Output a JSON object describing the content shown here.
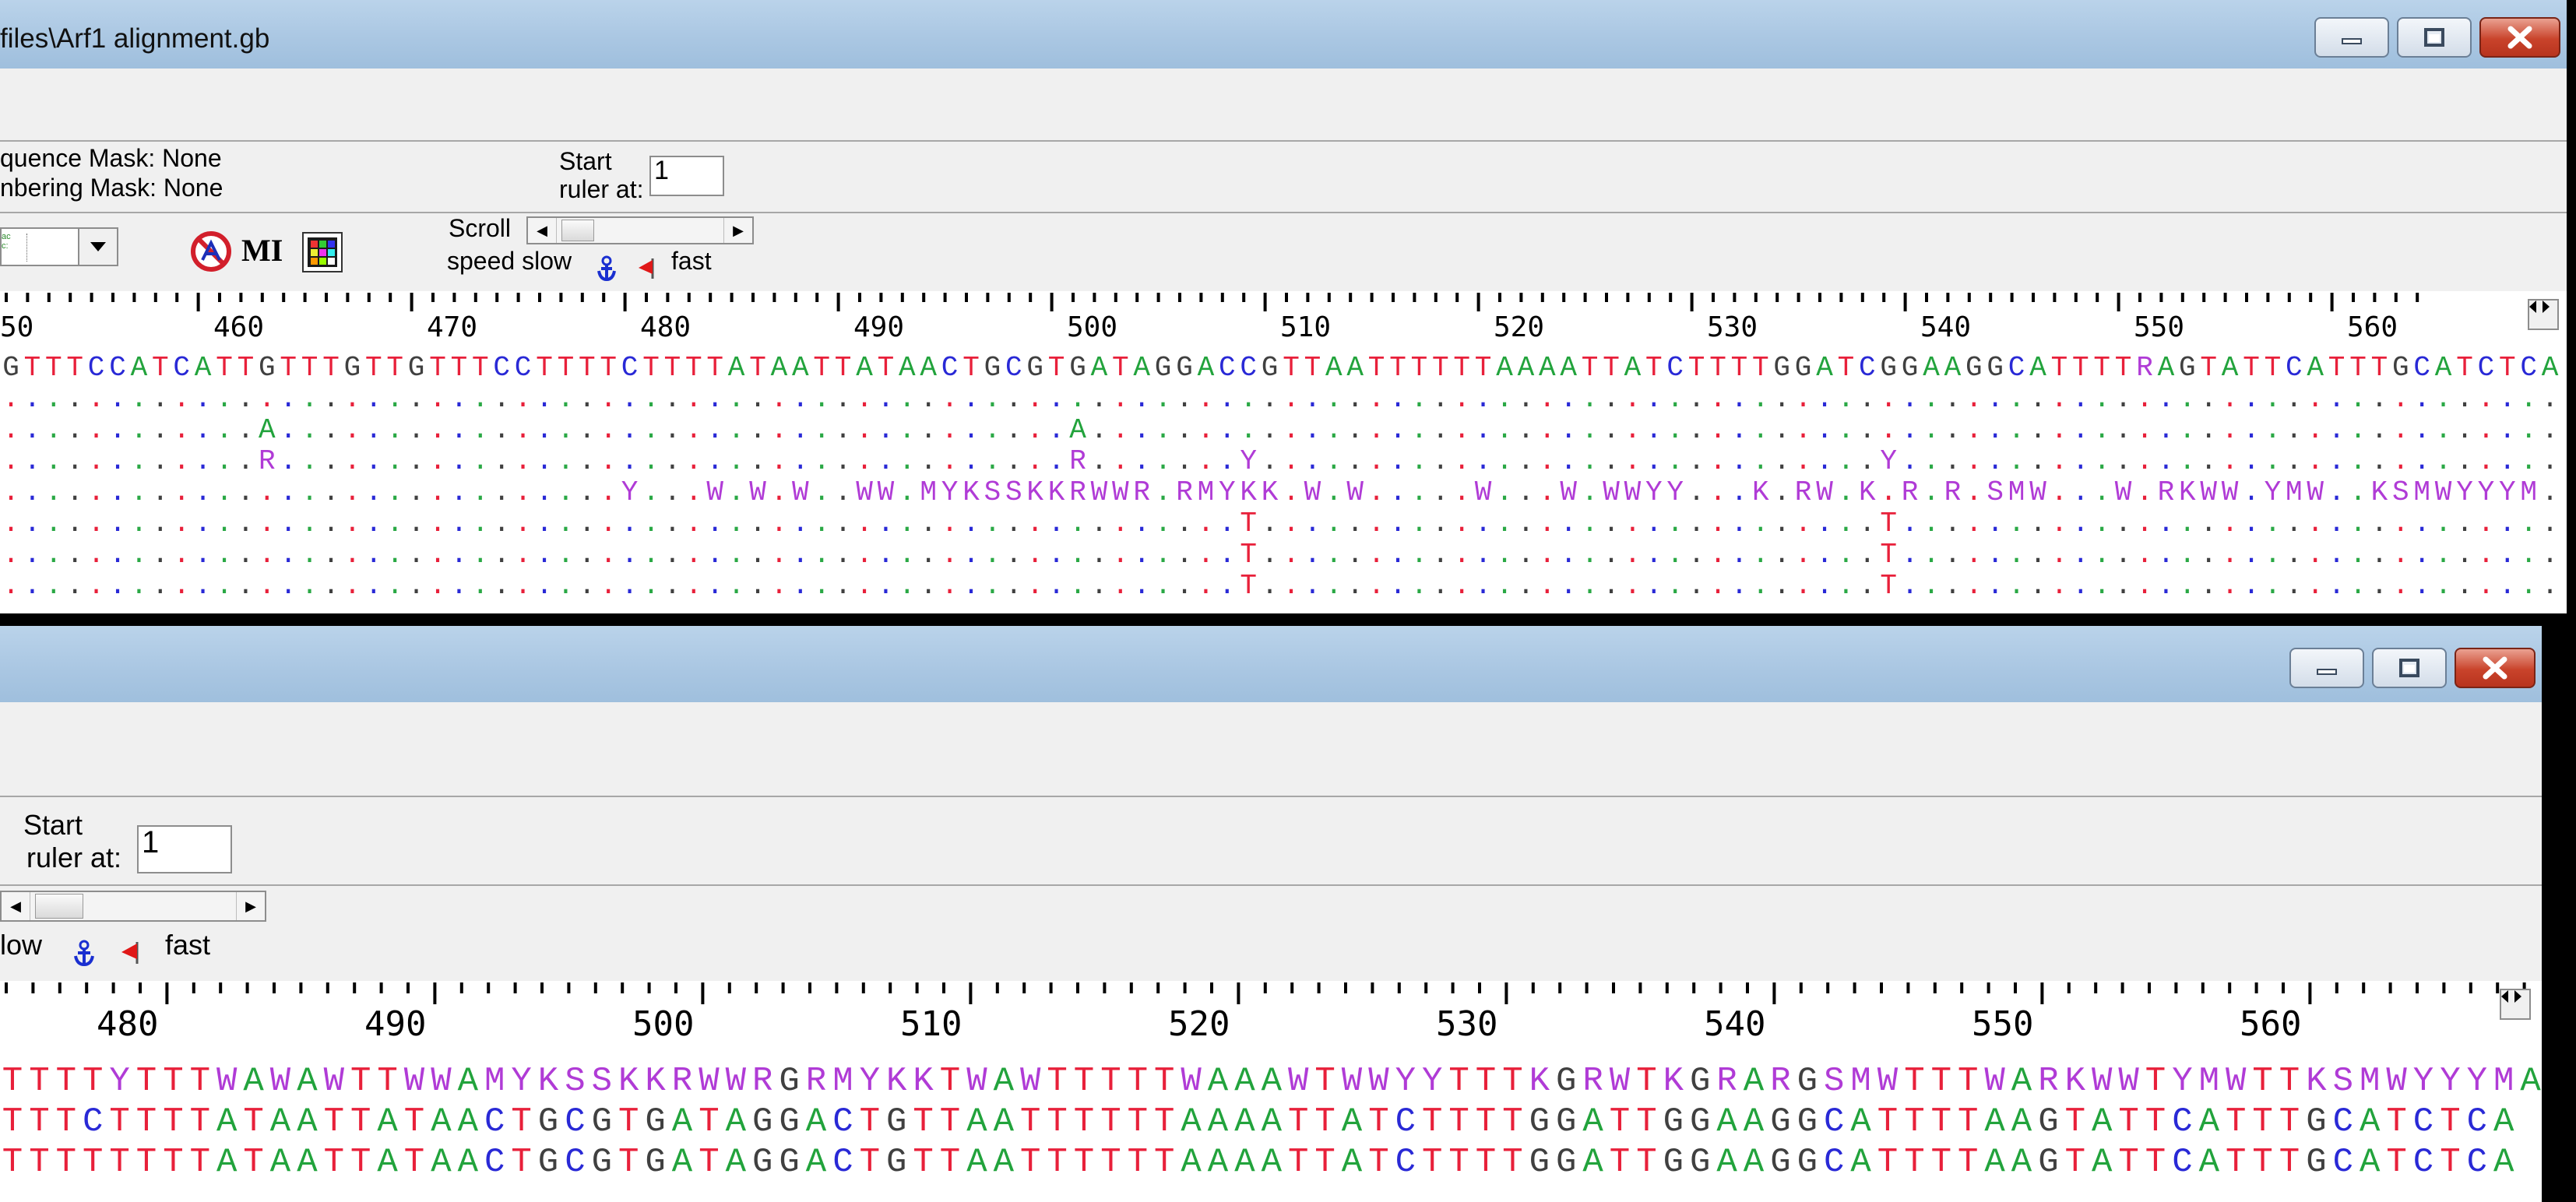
{
  "window1": {
    "title": "files\\Arf1 alignment.gb",
    "seq_mask": "quence Mask: None",
    "num_mask": "nbering Mask: None",
    "start_label1": "Start",
    "start_label2": "ruler at:",
    "start_value": "1",
    "scroll_label": "Scroll",
    "speed_slow": "speed slow",
    "speed_fast": "fast",
    "mi_label": "MI",
    "ruler_labels": [
      "50",
      "460",
      "470",
      "480",
      "490",
      "500",
      "510",
      "520",
      "530",
      "540",
      "550",
      "560"
    ]
  },
  "window2": {
    "start_label1": "Start",
    "start_label2": "ruler at:",
    "start_value": "1",
    "speed_slow": "low",
    "speed_fast": "fast",
    "ruler_labels": [
      "480",
      "490",
      "500",
      "510",
      "520",
      "530",
      "540",
      "550",
      "560"
    ]
  },
  "tracks1": [
    "GTTTCCATCATTGTTTGTTGTTTCCTTTTCTTTTATAATTATAACTGCGTGATAGGACCGTTAATTTTTTAAAATTATCTTTTGGATCGGAAGGCATTTTRAGTATTCATTTGCATCTCA",
    "........................................................................................................................",
    "............A.....................................A.....................................................................",
    "............R.....................................R.......Y.............................Y...............................",
    ".............................Y...W.W.W..WW.MYKSSKKRWWR.RMYKK.W.W.....W...W.WWYY...K.RW.K.R.R.SMW...W.RKWW.YMW..KSMWYYYM.",
    "..........................................................T.............................T...............................",
    "..........................................................T.............................T...............................",
    "..........................................................T.............................T..............................."
  ],
  "tracks2": [
    "TTTTYTTTWAWAWTTWWAMYKSSKKRWWRGRMYKKTWAWTTTTTWAAAWTWWYYTTTKGRWTKGRARGSMWTTTWARKWWTYMWTTKSMWYYYMA",
    "TTTCTTTTATAATTATAACTGCGTGATAGGACTGTTAATTTTTTAAAATTATCTTTTGGATTGGAAGGCATTTTAAGTATTCATTTGCATCTCA",
    "TTTTTTTTATAATTATAACTGCGTGATAGGACTGTTAATTTTTTAAAATTATCTTTTGGATTGGAAGGCATTTTAAGTATTCATTTGCATCTCA"
  ],
  "colors": {
    "A": "#22a33c",
    "C": "#2929d6",
    "G": "#404040",
    "T": "#e8203a",
    "ambig": "#b03bd6",
    "dotA": "#2aa845"
  },
  "icons": [
    "minimize-icon",
    "maximize-icon",
    "close-icon",
    "anchor-icon",
    "flag-icon",
    "restriction-icon",
    "color-grid-icon"
  ]
}
